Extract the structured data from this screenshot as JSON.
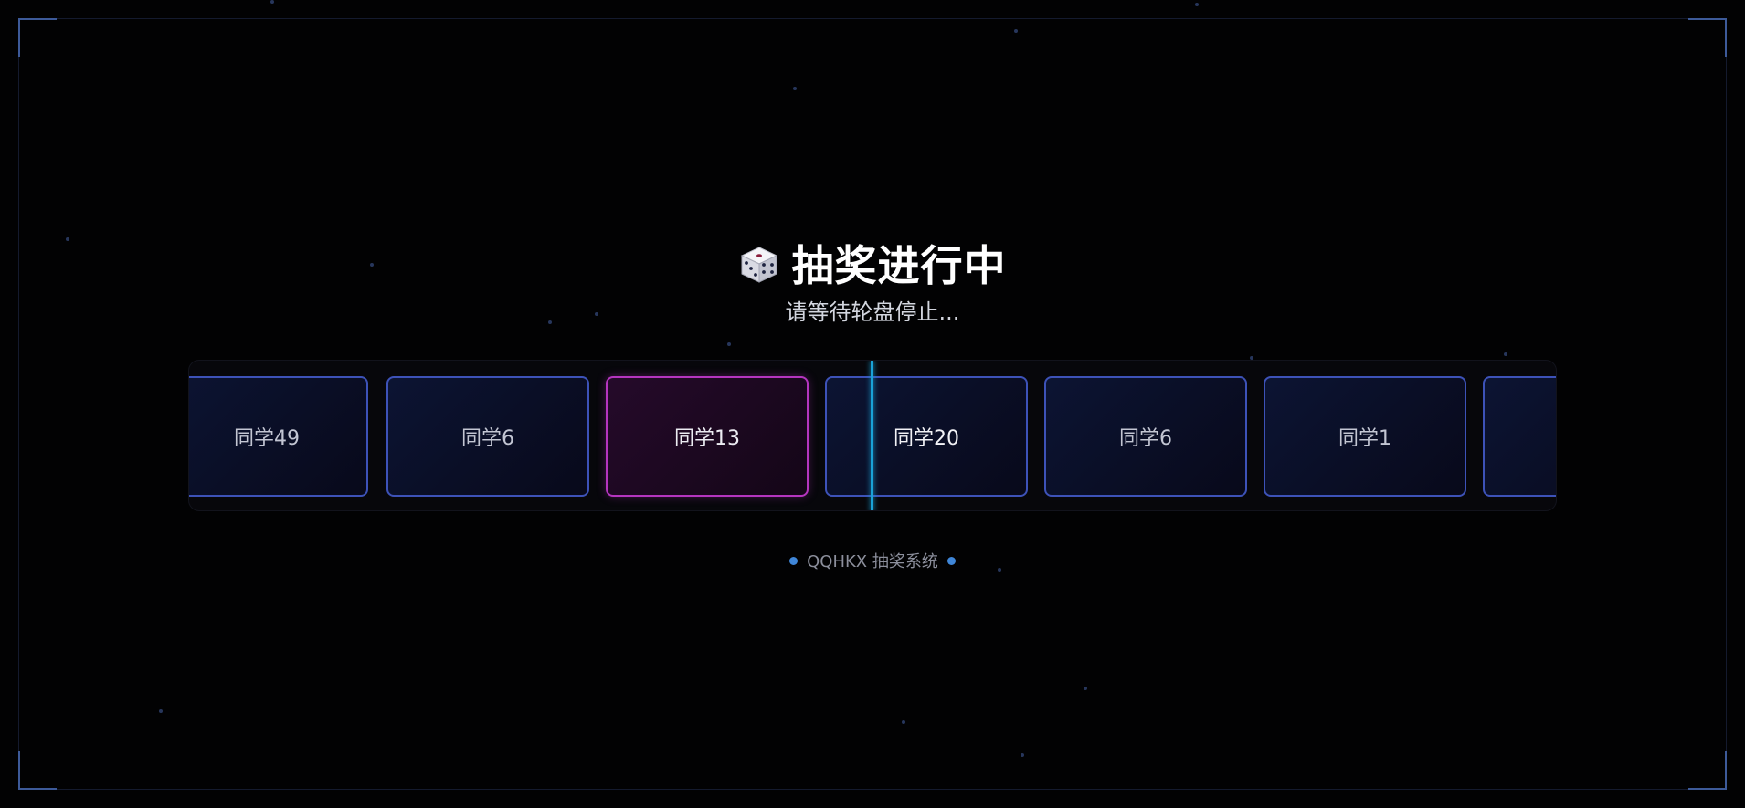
{
  "header": {
    "title": "抽奖进行中",
    "subtitle": "请等待轮盘停止...",
    "icon": "dice-icon"
  },
  "reel": {
    "cards": [
      {
        "label": "同学49"
      },
      {
        "label": "同学6"
      },
      {
        "label": "同学13",
        "highlighted": true
      },
      {
        "label": "同学20"
      },
      {
        "label": "同学6"
      },
      {
        "label": "同学1"
      },
      {
        "label": ""
      }
    ]
  },
  "footer": {
    "label": "QQHKX 抽奖系统"
  },
  "colors": {
    "background": "#020203",
    "card_border": "#3d52b8",
    "highlight_border": "#b535bf",
    "pointer": "#1aa2d8",
    "footer_dot": "#3f86d8",
    "corner": "#3d5a99"
  }
}
